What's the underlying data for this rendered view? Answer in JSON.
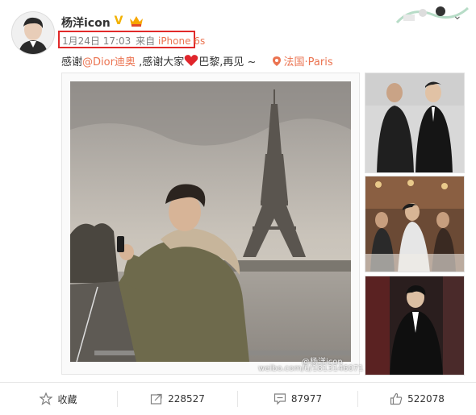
{
  "user": {
    "name": "杨洋icon",
    "verified_badge": "V",
    "avatar_icon": "avatar-portrait",
    "crown_icon": "vip-crown-icon"
  },
  "post": {
    "time": "1月24日 17:03",
    "source_prefix": "来自",
    "device": "iPhone 6s",
    "text_part1": "感谢",
    "mention": "@Dior迪奥",
    "text_part2": " ,感谢大家",
    "text_part3": "巴黎,再见 ~",
    "location": "法国·Paris",
    "heart_icon": "heart-emoji-icon",
    "location_icon": "location-pin-icon"
  },
  "photos": {
    "main_alt": "Man taking selfie in front of the Eiffel Tower",
    "watermark_name": "@杨洋icon",
    "watermark_url": "weibo.com/u/1813146071",
    "thumb_icons": [
      "photo-two-men-suits",
      "photo-group-dinner",
      "photo-man-black-suit"
    ]
  },
  "actions": {
    "favorite_label": "收藏",
    "repost_count": "228527",
    "comment_count": "87977",
    "like_count": "522078"
  },
  "colors": {
    "accent_orange": "#eb7350",
    "highlight_red": "#e12a2a",
    "badge_gold": "#f2b100",
    "meta_gray": "#808080"
  }
}
